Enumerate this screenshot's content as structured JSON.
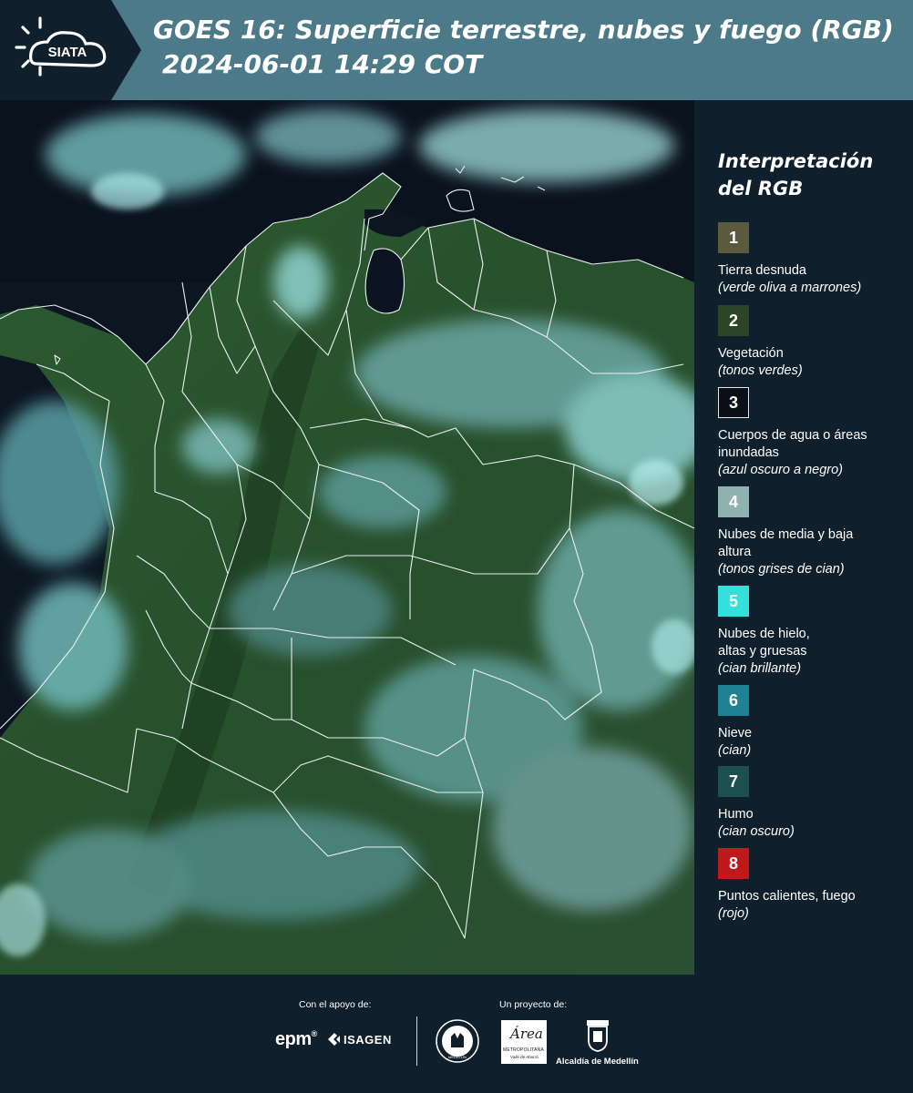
{
  "header": {
    "brand": "SIATA",
    "title_line1": "GOES 16: Superficie terrestre, nubes y fuego (RGB)",
    "title_line2": "2024-06-01 14:29 COT"
  },
  "legend": {
    "title_line1": "Interpretación",
    "title_line2": "del RGB",
    "items": [
      {
        "number": "1",
        "label": "Tierra desnuda",
        "sub": "(verde oliva a marrones)",
        "color": "#5b5a3f"
      },
      {
        "number": "2",
        "label": "Vegetación",
        "sub": "(tonos verdes)",
        "color": "#2c4526"
      },
      {
        "number": "3",
        "label": "Cuerpos de agua o áreas inundadas",
        "sub": "(azul oscuro a negro)",
        "color": "#0b0f1a"
      },
      {
        "number": "4",
        "label": "Nubes de media y baja altura",
        "sub": "(tonos grises de cian)",
        "color": "#8fb1b0"
      },
      {
        "number": "5",
        "label": "Nubes de hielo, altas y gruesas",
        "sub": "(cian brillante)",
        "color": "#33e0dc"
      },
      {
        "number": "6",
        "label": "Nieve",
        "sub": "(cian)",
        "color": "#1f8294"
      },
      {
        "number": "7",
        "label": "Humo",
        "sub": "(cian oscuro)",
        "color": "#1d4f50"
      },
      {
        "number": "8",
        "label": "Puntos calientes, fuego",
        "sub": "(rojo)",
        "color": "#c0191c"
      }
    ]
  },
  "footer": {
    "support_label": "Con el apoyo de:",
    "project_label": "Un proyecto de:",
    "sponsor_epm": "epm",
    "sponsor_isagen": "ISAGEN",
    "area_metro_line1": "Área",
    "area_metro_line2": "METROPOLITANA",
    "area_metro_line3": "Valle de Aburrá",
    "alcaldia": "Alcaldía de Medellín",
    "seal_text": "MEDELLÍN"
  }
}
